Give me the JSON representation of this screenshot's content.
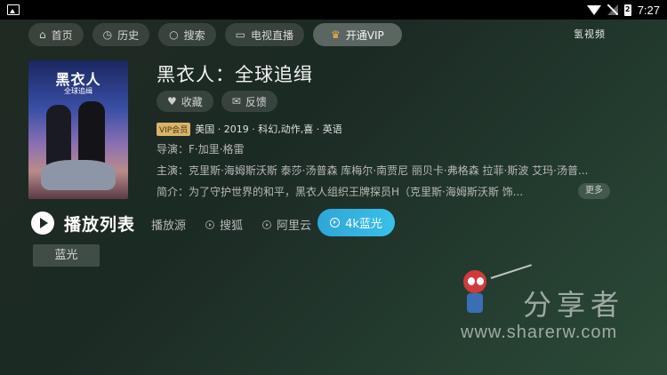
{
  "status_bar": {
    "time": "7:27",
    "battery_label": "2"
  },
  "nav": {
    "items": [
      {
        "label": "首页",
        "icon": "home-icon"
      },
      {
        "label": "历史",
        "icon": "clock-icon"
      },
      {
        "label": "搜索",
        "icon": "search-icon"
      },
      {
        "label": "电视直播",
        "icon": "tv-icon"
      },
      {
        "label": "开通VIP",
        "icon": "crown-icon"
      }
    ],
    "brand": "氢视频"
  },
  "poster": {
    "title": "黑衣人",
    "subtitle": "全球追缉"
  },
  "movie": {
    "title": "黑衣人：全球追缉",
    "actions": [
      {
        "label": "收藏",
        "icon": "heart-icon"
      },
      {
        "label": "反馈",
        "icon": "feedback-icon"
      }
    ],
    "vip_badge": "VIP会员",
    "meta": "美国 · 2019 · 科幻,动作,喜 · 英语",
    "director": "导演：F·加里·格雷",
    "cast": "主演：克里斯·海姆斯沃斯 泰莎·汤普森 库梅尔·南贾尼 丽贝卡·弗格森 拉菲·斯波 艾玛·汤普...",
    "synopsis": "简介：为了守护世界的和平，黑衣人组织王牌探员H（克里斯·海姆斯沃斯 饰...",
    "more_label": "更多"
  },
  "playlist": {
    "title": "播放列表",
    "source_label": "播放源",
    "sources": [
      "搜狐",
      "阿里云"
    ],
    "active_source": "4k蓝光",
    "episodes": [
      "蓝光"
    ]
  },
  "watermark": {
    "text": "分享者",
    "url": "www.sharerw.com"
  },
  "colors": {
    "accent": "#2ea6d8",
    "vip_gold": "#d9b36b",
    "background": "#1f2a22"
  }
}
